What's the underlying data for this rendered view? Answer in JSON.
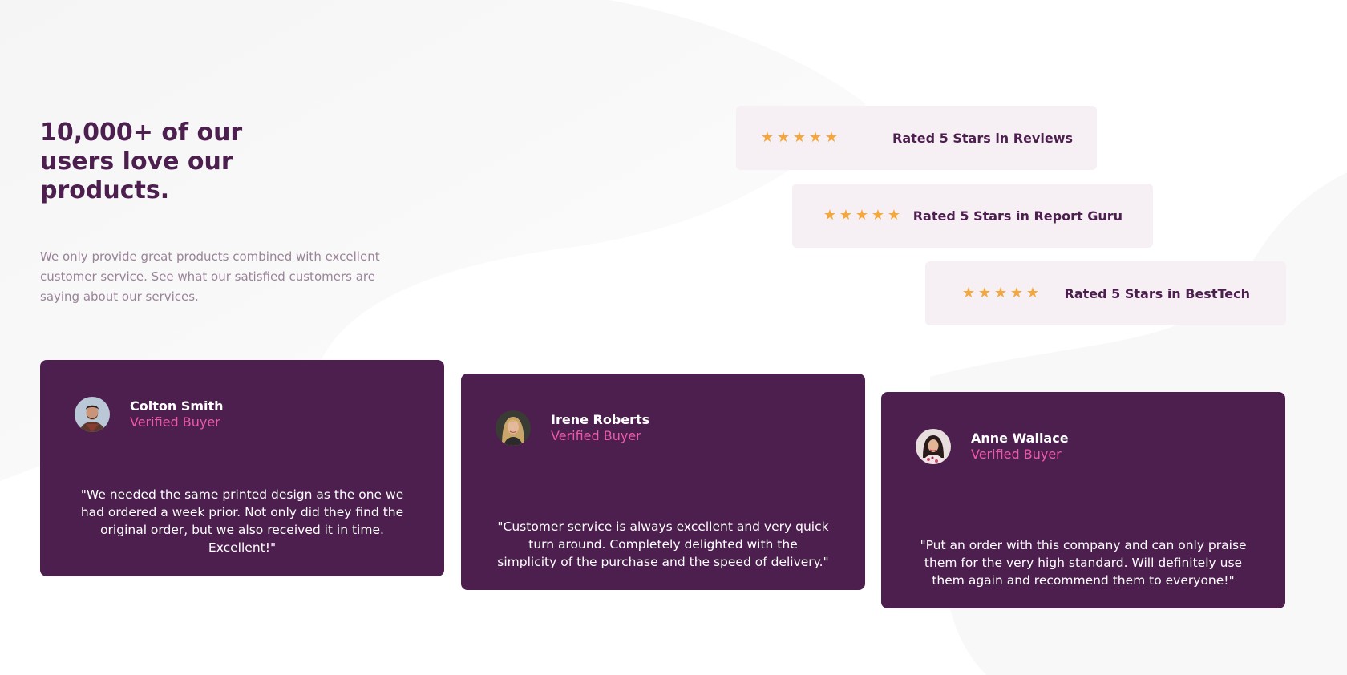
{
  "hero": {
    "title": "10,000+ of our users love our products.",
    "description": "We only provide great products combined with excellent customer service. See what our satisfied customers are saying about our services."
  },
  "ratings": [
    {
      "stars": 5,
      "label": "Rated 5 Stars in Reviews"
    },
    {
      "stars": 5,
      "label": "Rated 5 Stars in Report Guru"
    },
    {
      "stars": 5,
      "label": "Rated 5 Stars in BestTech"
    }
  ],
  "testimonials": [
    {
      "name": "Colton Smith",
      "status": "Verified Buyer",
      "quote": "\"We needed the same printed design as the one we had ordered a week prior. Not only did they find the original order, but we also received it in time. Excellent!\""
    },
    {
      "name": "Irene Roberts",
      "status": "Verified Buyer",
      "quote": "\"Customer service is always excellent and very quick turn around. Completely delighted with the simplicity of the purchase and the speed of delivery.\""
    },
    {
      "name": "Anne Wallace",
      "status": "Verified Buyer",
      "quote": "\"Put an order with this company and can only praise them for the very high standard. Will definitely use them again and recommend them to everyone!\""
    }
  ],
  "colors": {
    "accent": "#4d1f4f",
    "star": "#f4a73c",
    "verified": "#ec5aa7",
    "rating_bg": "#f6f0f5",
    "muted_text": "#9a8398"
  }
}
